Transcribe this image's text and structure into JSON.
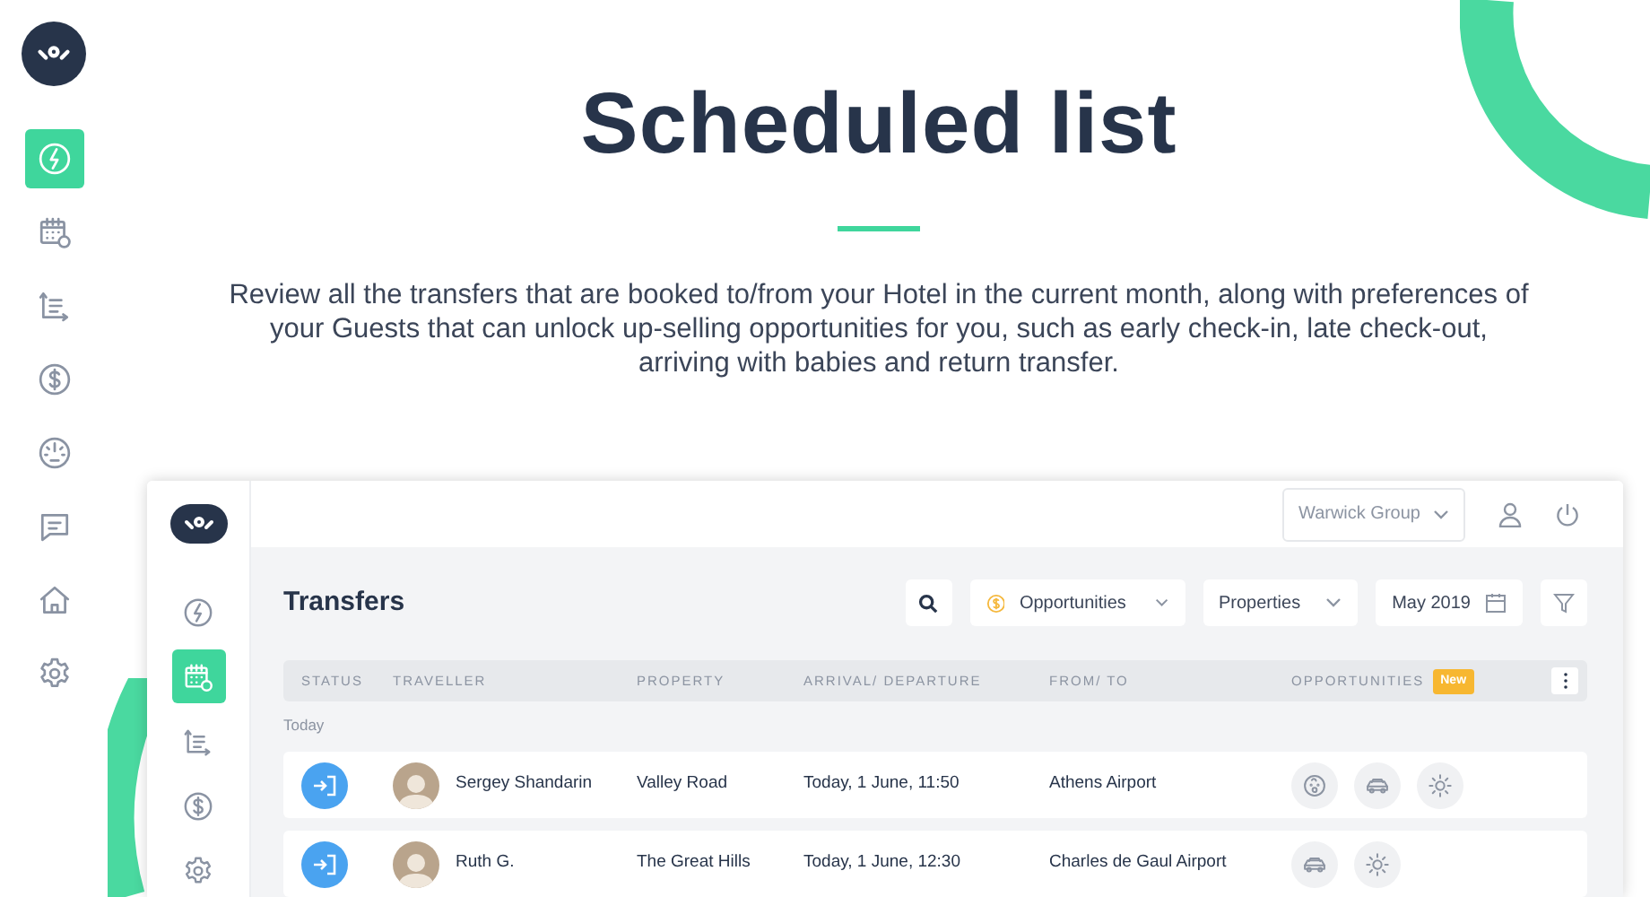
{
  "sidebar": {
    "items": [
      {
        "kind": "bolt",
        "selected": true
      },
      {
        "kind": "calendar",
        "selected": false
      },
      {
        "kind": "chart",
        "selected": false
      },
      {
        "kind": "dollar",
        "selected": false
      },
      {
        "kind": "gauge",
        "selected": false
      },
      {
        "kind": "chat",
        "selected": false
      },
      {
        "kind": "home",
        "selected": false
      },
      {
        "kind": "gear",
        "selected": false
      }
    ]
  },
  "hero": {
    "title": "Scheduled list",
    "description": "Review all the transfers that are booked to/from your Hotel in the current month, along with preferences of your Guests that can unlock up-selling opportunities for you, such as early check-in, late check-out, arriving with babies and return transfer."
  },
  "app": {
    "sidebar": {
      "items": [
        {
          "kind": "bolt",
          "selected": false
        },
        {
          "kind": "calendar",
          "selected": true
        },
        {
          "kind": "chart",
          "selected": false
        },
        {
          "kind": "dollar",
          "selected": false
        },
        {
          "kind": "gear",
          "selected": false
        }
      ]
    },
    "header": {
      "account": "Warwick Group"
    },
    "page_title": "Transfers",
    "filters": [
      {
        "kind": "opportunities",
        "label": "Opportunities"
      },
      {
        "kind": "dropdown",
        "label": "Properties"
      },
      {
        "kind": "date",
        "label": "May 2019"
      }
    ],
    "table": {
      "columns": [
        "STATUS",
        "TRAVELLER",
        "PROPERTY",
        "ARRIVAL/ DEPARTURE",
        "FROM/ TO",
        "OPPORTUNITIES"
      ],
      "badge": "New",
      "groups": [
        {
          "label": "Today",
          "rows": [
            {
              "kind": "arrival",
              "traveller": "Sergey Shandarin",
              "property": "Valley Road",
              "time": "Today, 1 June, 11:50",
              "route": "Athens Airport",
              "opportunities": [
                {
                  "kind": "baby"
                },
                {
                  "kind": "car"
                },
                {
                  "kind": "sun"
                }
              ]
            },
            {
              "kind": "arrival",
              "traveller": "Ruth G.",
              "property": "The Great Hills",
              "time": "Today, 1 June, 12:30",
              "route": "Charles de Gaul Airport",
              "opportunities": [
                {
                  "kind": "car"
                },
                {
                  "kind": "sun"
                }
              ]
            }
          ]
        }
      ]
    }
  }
}
